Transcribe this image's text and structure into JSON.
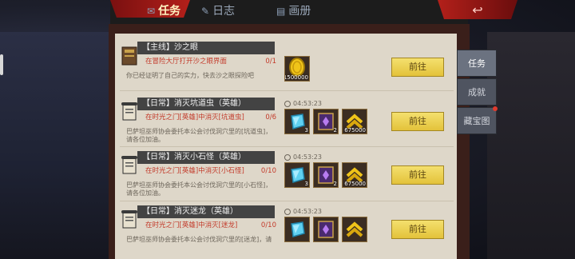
{
  "header": {
    "tabs": [
      {
        "label": "任务",
        "icon": "scroll-icon",
        "active": true
      },
      {
        "label": "日志",
        "icon": "quill-icon",
        "active": false
      },
      {
        "label": "画册",
        "icon": "book-icon",
        "active": false
      }
    ],
    "colors": {
      "active_tab": "#fff3c0",
      "inactive_tab": "#9aa7b8",
      "accent_red": "#b3201a"
    }
  },
  "side_tabs": [
    {
      "label": "任务",
      "active": true,
      "has_badge": false
    },
    {
      "label": "成就",
      "active": false,
      "has_badge": false
    },
    {
      "label": "藏宝图",
      "active": false,
      "has_badge": true
    }
  ],
  "quests": [
    {
      "title": "【主线】沙之眼",
      "goal": "在冒险大厅打开沙之眼界面",
      "count": "0/1",
      "description": "你已经证明了自己的实力，快去沙之眼探险吧",
      "timer": "",
      "rewards": [
        {
          "icon": "gold-coin-icon",
          "amount": "1500000"
        }
      ],
      "button": "前往"
    },
    {
      "title": "【日常】消灭坑道虫（英雄）",
      "goal": "在时光之门[英雄]中消灭[坑道虫]",
      "count": "0/6",
      "description": "巴萨坦巫师协会委托本公会讨伐洞穴里的[坑道虫]，请各位加油。",
      "timer": "04:53:23",
      "rewards": [
        {
          "icon": "blue-crystal-icon",
          "amount": "3"
        },
        {
          "icon": "purple-tome-icon",
          "amount": "2"
        },
        {
          "icon": "gold-rank-icon",
          "amount": "675000"
        }
      ],
      "button": "前往"
    },
    {
      "title": "【日常】消灭小石怪（英雄）",
      "goal": "在时光之门[英雄]中消灭[小石怪]",
      "count": "0/10",
      "description": "巴萨坦巫师协会委托本公会讨伐洞穴里的[小石怪]，请各位加油。",
      "timer": "04:53:23",
      "rewards": [
        {
          "icon": "blue-crystal-icon",
          "amount": "3"
        },
        {
          "icon": "purple-tome-icon",
          "amount": "2"
        },
        {
          "icon": "gold-rank-icon",
          "amount": "675000"
        }
      ],
      "button": "前往"
    },
    {
      "title": "【日常】消灭迷龙（英雄）",
      "goal": "在时光之门[英雄]中消灭[迷龙]",
      "count": "0/10",
      "description": "巴萨坦巫师协会委托本公会讨伐洞穴里的[迷龙]，请",
      "timer": "04:53:23",
      "rewards": [
        {
          "icon": "blue-crystal-icon",
          "amount": ""
        },
        {
          "icon": "purple-tome-icon",
          "amount": ""
        },
        {
          "icon": "gold-rank-icon",
          "amount": ""
        }
      ],
      "button": "前往"
    }
  ]
}
